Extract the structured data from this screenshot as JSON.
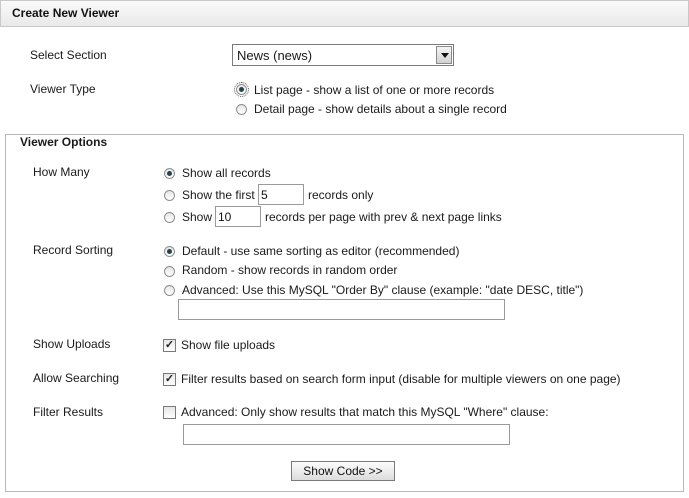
{
  "header": {
    "title": "Create New Viewer"
  },
  "select_section": {
    "label": "Select Section",
    "value": "News (news)"
  },
  "viewer_type": {
    "label": "Viewer Type",
    "options": [
      {
        "label": "List page - show a list of one or more records",
        "checked": true
      },
      {
        "label": "Detail page - show details about a single record",
        "checked": false
      }
    ]
  },
  "viewer_options": {
    "legend": "Viewer Options",
    "how_many": {
      "label": "How Many",
      "show_all": "Show all records",
      "show_first_prefix": "Show the first",
      "show_first_value": "5",
      "show_first_suffix": "records only",
      "show_prefix": "Show",
      "per_page_value": "10",
      "per_page_suffix": "records per page with prev & next page links"
    },
    "record_sorting": {
      "label": "Record Sorting",
      "default": "Default - use same sorting as editor (recommended)",
      "random": "Random - show records in random order",
      "advanced": "Advanced: Use this MySQL \"Order By\" clause (example: \"date DESC, title\")",
      "order_by_value": ""
    },
    "show_uploads": {
      "label": "Show Uploads",
      "option": "Show file uploads",
      "checked": true
    },
    "allow_searching": {
      "label": "Allow Searching",
      "option": "Filter results based on search form input (disable for multiple viewers on one page)",
      "checked": true
    },
    "filter_results": {
      "label": "Filter Results",
      "option": "Advanced: Only show results that match this MySQL \"Where\" clause:",
      "checked": false,
      "where_value": ""
    }
  },
  "show_code_button": "Show Code >>"
}
